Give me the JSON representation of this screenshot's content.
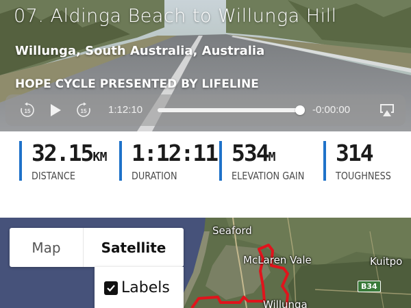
{
  "video": {
    "title": "07. Aldinga Beach to Willunga Hill",
    "location": "Willunga, South Australia, Australia",
    "presenter": "HOPE CYCLE PRESENTED BY LIFELINE",
    "controls": {
      "skip_back_seconds": "15",
      "skip_forward_seconds": "15",
      "elapsed": "1:12:10",
      "remaining": "-0:00:00",
      "progress_fraction": 0.99
    }
  },
  "stats": [
    {
      "value": "32.15",
      "unit": "KM",
      "label": "DISTANCE"
    },
    {
      "value": "1:12:11",
      "unit": "",
      "label": "DURATION"
    },
    {
      "value": "534",
      "unit": "M",
      "label": "ELEVATION GAIN"
    },
    {
      "value": "314",
      "unit": "",
      "label": "TOUGHNESS"
    }
  ],
  "map": {
    "type_options": {
      "map": "Map",
      "satellite": "Satellite",
      "selected": "Satellite"
    },
    "labels_option": {
      "label": "Labels",
      "checked": true
    },
    "places": [
      "Seaford",
      "McLaren Vale",
      "Kuitpo",
      "Willunga"
    ],
    "road_shield": "B34"
  },
  "colors": {
    "accent_bar": "#1f72c9",
    "route": "#e0141c",
    "sea": "#46527a"
  },
  "icons": [
    "skip-back-15-icon",
    "play-icon",
    "skip-forward-15-icon",
    "airplay-icon",
    "checkbox-checked-icon"
  ]
}
